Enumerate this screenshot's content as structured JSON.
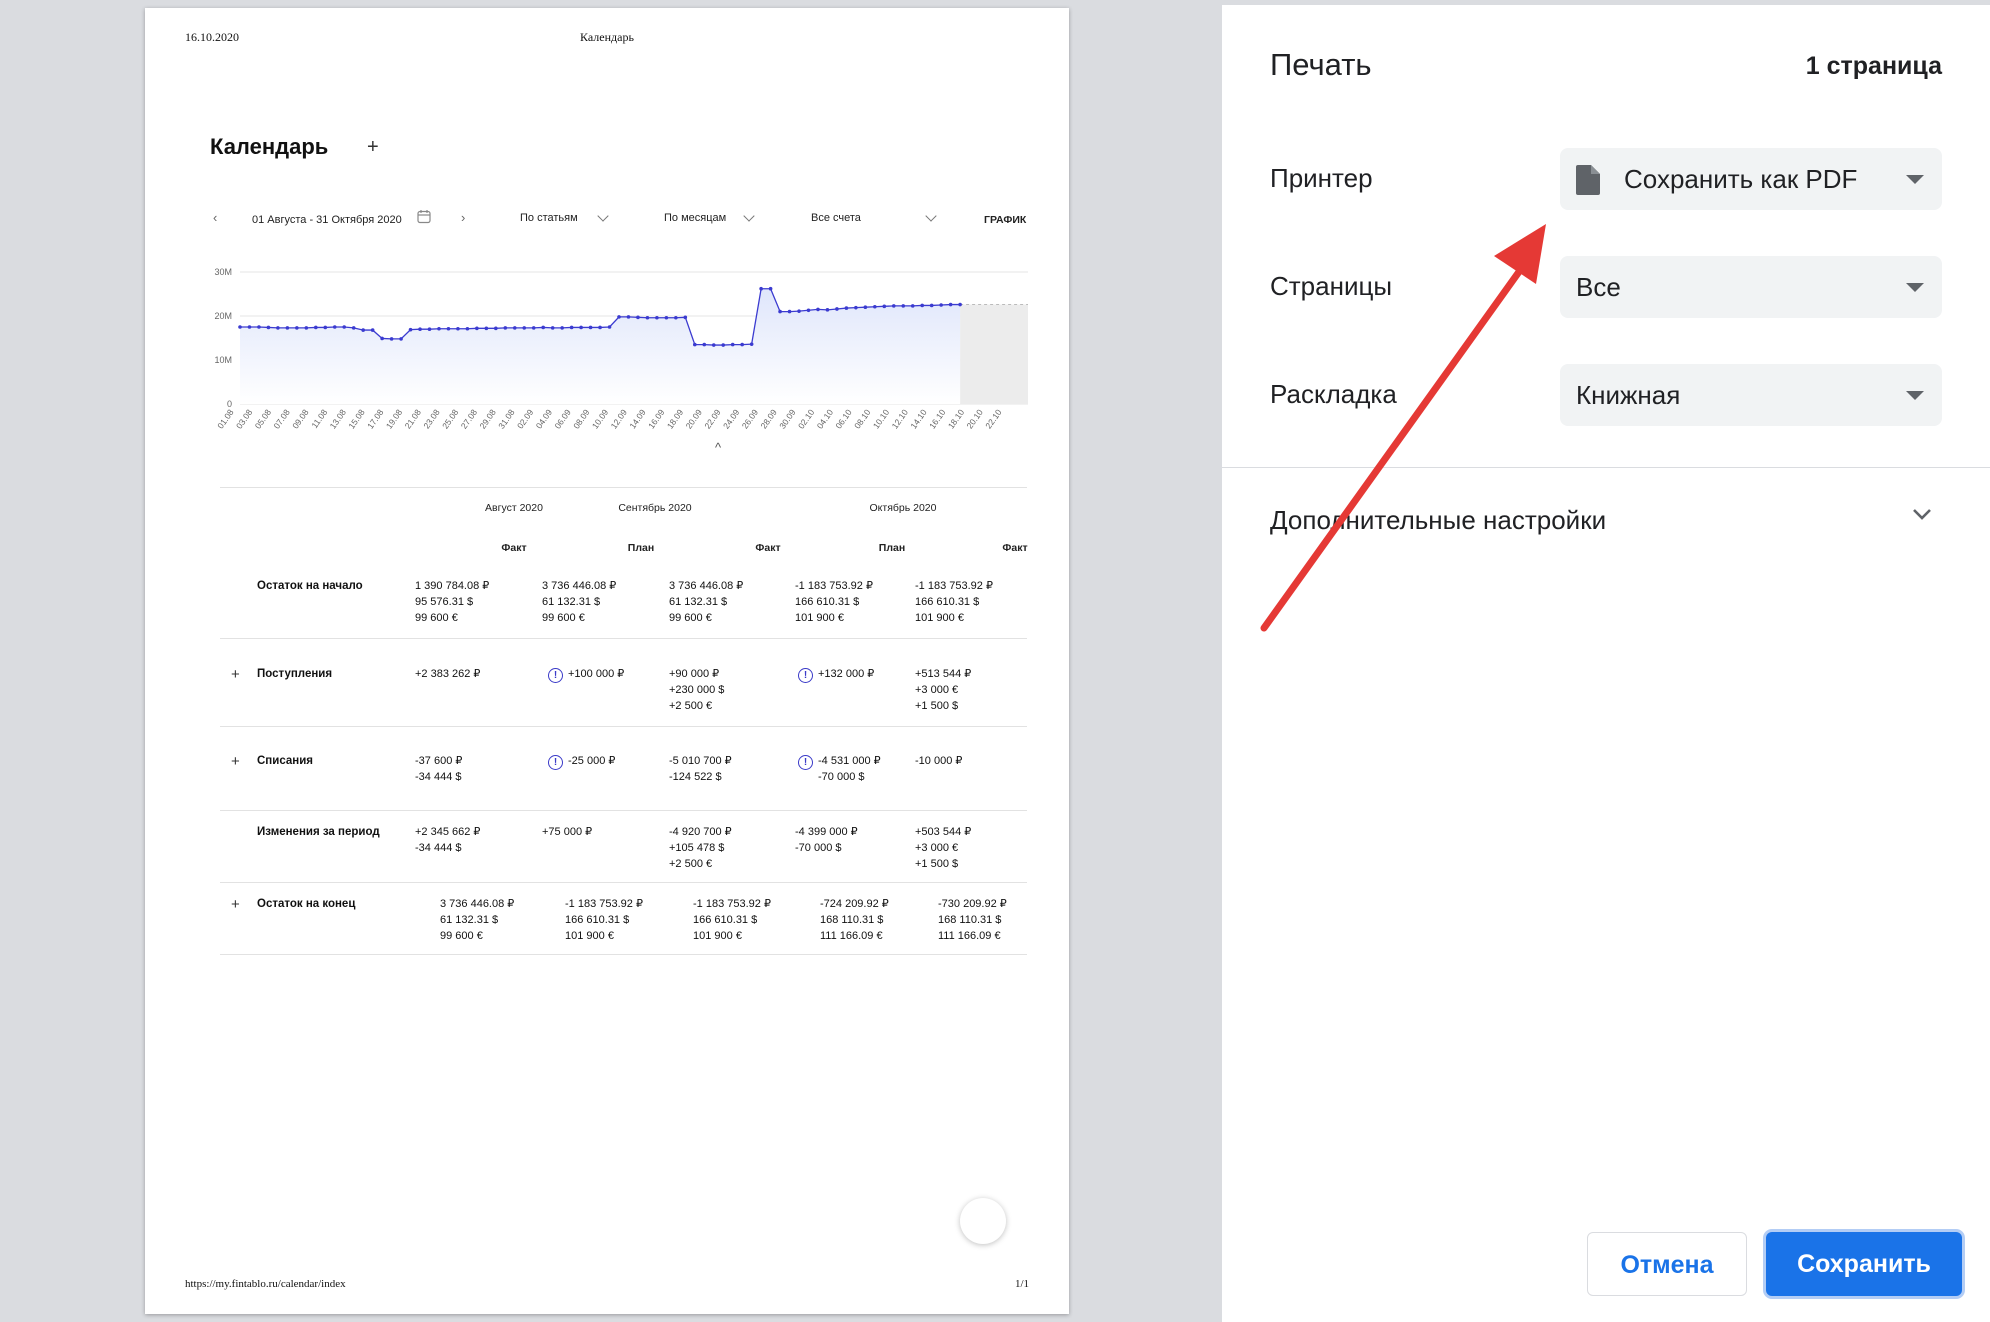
{
  "preview": {
    "header_date": "16.10.2020",
    "header_title": "Календарь",
    "footer_url": "https://my.fintablo.ru/calendar/index",
    "footer_page": "1/1",
    "page_title": "Календарь",
    "add_symbol": "+",
    "toolbar": {
      "prev_icon": "‹",
      "date_range": "01 Августа - 31 Октября 2020",
      "next_icon": "›",
      "group_by": "По статьям",
      "period": "По месяцам",
      "accounts": "Все счета",
      "view_toggle": "ГРАФИК"
    },
    "collapse_symbol": "^",
    "table": {
      "months": [
        "Август 2020",
        "Сентябрь 2020",
        "Октябрь 2020"
      ],
      "col_headers": [
        "Факт",
        "План",
        "Факт",
        "План",
        "Факт"
      ],
      "rows": [
        {
          "label": "Остаток на начало",
          "plus": "",
          "cells": [
            {
              "warn": false,
              "lines": [
                "1 390 784.08 ₽",
                "95 576.31 $",
                "99 600 €"
              ]
            },
            {
              "warn": false,
              "lines": [
                "3 736 446.08 ₽",
                "61 132.31 $",
                "99 600 €"
              ]
            },
            {
              "warn": false,
              "lines": [
                "3 736 446.08 ₽",
                "61 132.31 $",
                "99 600 €"
              ]
            },
            {
              "warn": false,
              "lines": [
                "-1 183 753.92 ₽",
                "166 610.31 $",
                "101 900 €"
              ]
            },
            {
              "warn": false,
              "lines": [
                "-1 183 753.92 ₽",
                "166 610.31 $",
                "101 900 €"
              ]
            }
          ]
        },
        {
          "label": "Поступления",
          "plus": "+",
          "cells": [
            {
              "warn": false,
              "lines": [
                "+2 383 262 ₽"
              ]
            },
            {
              "warn": true,
              "lines": [
                "+100 000 ₽"
              ]
            },
            {
              "warn": false,
              "lines": [
                "+90 000 ₽",
                "+230 000 $",
                "+2 500 €"
              ]
            },
            {
              "warn": true,
              "lines": [
                "+132 000 ₽"
              ]
            },
            {
              "warn": false,
              "lines": [
                "+513 544 ₽",
                "+3 000 €",
                "+1 500 $"
              ]
            }
          ]
        },
        {
          "label": "Списания",
          "plus": "+",
          "cells": [
            {
              "warn": false,
              "lines": [
                "-37 600 ₽",
                "-34 444 $"
              ]
            },
            {
              "warn": true,
              "lines": [
                "-25 000 ₽"
              ]
            },
            {
              "warn": false,
              "lines": [
                "-5 010 700 ₽",
                "-124 522 $"
              ]
            },
            {
              "warn": true,
              "lines": [
                "-4 531 000 ₽",
                "-70 000 $"
              ]
            },
            {
              "warn": false,
              "lines": [
                "-10 000 ₽"
              ]
            }
          ]
        },
        {
          "label": "Изменения за период",
          "plus": "",
          "cells": [
            {
              "warn": false,
              "lines": [
                "+2 345 662 ₽",
                "-34 444 $"
              ]
            },
            {
              "warn": false,
              "lines": [
                "+75 000 ₽"
              ]
            },
            {
              "warn": false,
              "lines": [
                "-4 920 700 ₽",
                "+105 478 $",
                "+2 500 €"
              ]
            },
            {
              "warn": false,
              "lines": [
                "-4 399 000 ₽",
                "-70 000 $"
              ]
            },
            {
              "warn": false,
              "lines": [
                "+503 544 ₽",
                "+3 000 €",
                "+1 500 $"
              ]
            }
          ]
        },
        {
          "label": "Остаток на конец",
          "plus": "+",
          "cells": [
            {
              "warn": false,
              "lines": [
                "3 736 446.08 ₽",
                "61 132.31 $",
                "99 600 €"
              ]
            },
            {
              "warn": false,
              "lines": [
                "-1 183 753.92 ₽",
                "166 610.31 $",
                "101 900 €"
              ]
            },
            {
              "warn": false,
              "lines": [
                "-1 183 753.92 ₽",
                "166 610.31 $",
                "101 900 €"
              ]
            },
            {
              "warn": false,
              "lines": [
                "-724 209.92 ₽",
                "168 110.31 $",
                "111 166.09 €"
              ]
            },
            {
              "warn": false,
              "lines": [
                "-730 209.92 ₽",
                "168 110.31 $",
                "111 166.09 €"
              ]
            }
          ]
        }
      ]
    }
  },
  "chart_data": {
    "type": "line",
    "title": "",
    "xlabel": "",
    "ylabel": "",
    "ylim": [
      0,
      30
    ],
    "y_ticks": [
      "0",
      "10M",
      "20M",
      "30M"
    ],
    "x_labels": [
      "01.08",
      "03.08",
      "05.08",
      "07.08",
      "09.08",
      "11.08",
      "13.08",
      "15.08",
      "17.08",
      "19.08",
      "21.08",
      "23.08",
      "25.08",
      "27.08",
      "29.08",
      "31.08",
      "02.09",
      "04.09",
      "06.09",
      "08.09",
      "10.09",
      "12.09",
      "14.09",
      "16.09",
      "18.09",
      "20.09",
      "22.09",
      "24.09",
      "26.09",
      "28.09",
      "30.09",
      "02.10",
      "04.10",
      "06.10",
      "08.10",
      "10.10",
      "12.10",
      "14.10",
      "16.10",
      "18.10",
      "20.10",
      "22.10"
    ],
    "forecast_from_index": 76,
    "line_color": "#3b3bd0",
    "fill_color": "#dfe6fb",
    "forecast_color": "#ececec",
    "series": [
      {
        "values": [
          17.5,
          17.5,
          17.5,
          17.4,
          17.3,
          17.3,
          17.3,
          17.3,
          17.4,
          17.4,
          17.5,
          17.5,
          17.3,
          16.8,
          16.8,
          14.9,
          14.8,
          14.8,
          16.9,
          17.0,
          17.0,
          17.1,
          17.1,
          17.1,
          17.1,
          17.2,
          17.2,
          17.2,
          17.3,
          17.3,
          17.3,
          17.3,
          17.4,
          17.3,
          17.3,
          17.4,
          17.4,
          17.4,
          17.4,
          17.5,
          19.8,
          19.8,
          19.7,
          19.6,
          19.6,
          19.6,
          19.6,
          19.7,
          13.5,
          13.5,
          13.4,
          13.4,
          13.5,
          13.5,
          13.6,
          26.2,
          26.2,
          21.0,
          21.0,
          21.1,
          21.3,
          21.5,
          21.4,
          21.6,
          21.8,
          21.9,
          22.0,
          22.1,
          22.2,
          22.3,
          22.3,
          22.3,
          22.4,
          22.4,
          22.5,
          22.6,
          22.6,
          22.6,
          22.6,
          22.6,
          22.6
        ]
      }
    ]
  },
  "settings": {
    "title": "Печать",
    "page_count": "1 страница",
    "printer_label": "Принтер",
    "printer_value": "Сохранить как PDF",
    "pages_label": "Страницы",
    "pages_value": "Все",
    "layout_label": "Раскладка",
    "layout_value": "Книжная",
    "more_settings": "Дополнительные настройки",
    "cancel": "Отмена",
    "save": "Сохранить"
  },
  "annotation": {
    "arrow_color": "#e53935"
  }
}
